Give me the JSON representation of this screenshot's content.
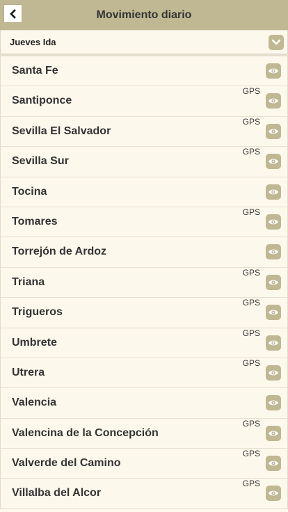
{
  "header": {
    "title": "Movimiento diario",
    "back_icon": "chevron-left-icon"
  },
  "selector": {
    "value": "Jueves Ida",
    "icon": "chevron-down-icon"
  },
  "colors": {
    "header_bg": "#c0b793",
    "page_bg": "#fdf8ec",
    "button_bg": "#c0b793"
  },
  "stops": [
    {
      "name": "Santa Fe",
      "gps": ""
    },
    {
      "name": "Santiponce",
      "gps": "GPS"
    },
    {
      "name": "Sevilla El Salvador",
      "gps": "GPS"
    },
    {
      "name": "Sevilla Sur",
      "gps": "GPS"
    },
    {
      "name": "Tocina",
      "gps": ""
    },
    {
      "name": "Tomares",
      "gps": "GPS"
    },
    {
      "name": "Torrejón de Ardoz",
      "gps": ""
    },
    {
      "name": "Triana",
      "gps": "GPS"
    },
    {
      "name": "Trigueros",
      "gps": "GPS"
    },
    {
      "name": "Umbrete",
      "gps": "GPS"
    },
    {
      "name": "Utrera",
      "gps": "GPS"
    },
    {
      "name": "Valencia",
      "gps": ""
    },
    {
      "name": "Valencina de la Concepción",
      "gps": "GPS"
    },
    {
      "name": "Valverde del Camino",
      "gps": "GPS"
    },
    {
      "name": "Villalba del Alcor",
      "gps": "GPS"
    }
  ]
}
